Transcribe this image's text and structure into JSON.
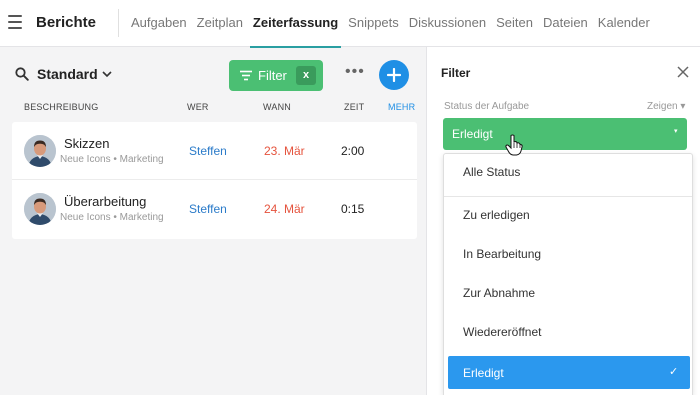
{
  "app": {
    "title": "Berichte"
  },
  "nav": {
    "tabs": [
      {
        "label": "Aufgaben"
      },
      {
        "label": "Zeitplan"
      },
      {
        "label": "Zeiterfassung",
        "active": true
      },
      {
        "label": "Snippets"
      },
      {
        "label": "Diskussionen"
      },
      {
        "label": "Seiten"
      },
      {
        "label": "Dateien"
      },
      {
        "label": "Kalender"
      }
    ]
  },
  "toolbar": {
    "view_name": "Standard",
    "filter_label": "Filter",
    "filter_clear": "x",
    "more_label": "•••"
  },
  "columns": {
    "description": "BESCHREIBUNG",
    "who": "WER",
    "when": "WANN",
    "time": "ZEIT",
    "more": "MEHR"
  },
  "entries": [
    {
      "title": "Skizzen",
      "project": "Neue Icons",
      "category": "Marketing",
      "separator": " • ",
      "who": "Steffen",
      "when": "23. Mär",
      "time": "2:00"
    },
    {
      "title": "Überarbeitung",
      "project": "Neue Icons",
      "category": "Marketing",
      "separator": " • ",
      "who": "Steffen",
      "when": "24. Mär",
      "time": "0:15"
    }
  ],
  "filter_panel": {
    "title": "Filter",
    "status_label": "Status der Aufgabe",
    "show_link": "Zeigen",
    "show_caret": "▾",
    "selected_value": "Erledigt",
    "select_caret": "▾",
    "options": [
      {
        "label": "Alle Status"
      },
      {
        "label": "Zu erledigen"
      },
      {
        "label": "In Bearbeitung"
      },
      {
        "label": "Zur Abnahme"
      },
      {
        "label": "Wiedereröffnet"
      },
      {
        "label": "Erledigt",
        "selected": true,
        "check": "✓"
      }
    ]
  },
  "colors": {
    "accent_green": "#4bbf73",
    "accent_blue": "#1f8fe5",
    "active_tab_underline": "#2a9fa2",
    "date_red": "#e5533d",
    "link_blue": "#2b7bc9"
  }
}
